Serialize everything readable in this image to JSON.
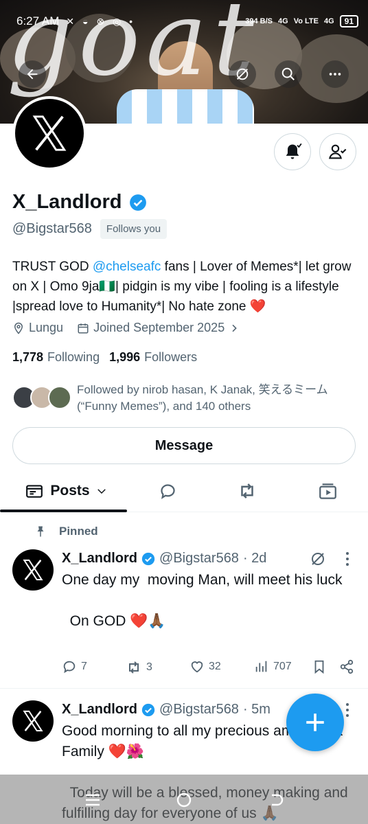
{
  "status_bar": {
    "time": "6:27 AM",
    "indicator_dots": "✕ ◒ ⊗ ◎ •",
    "net_speed": "394 B/S",
    "net1": "4G",
    "net2": "Vo LTE",
    "net3": "4G",
    "battery": "91"
  },
  "banner": {
    "overlay_text": "goat"
  },
  "profile": {
    "name": "X_Landlord",
    "handle": "@Bigstar568",
    "follows_you": "Follows you",
    "bio_before": "TRUST GOD ",
    "bio_mention": "@chelseafc",
    "bio_after": " fans | Lover of Memes*| let grow on X | Omo 9ja🇳🇬| pidgin is my vibe | fooling is a lifestyle |spread love to Humanity*| No hate zone ❤️",
    "location": "Lungu",
    "joined": "Joined September 2025",
    "following_count": "1,778",
    "following_label": "Following",
    "followers_count": "1,996",
    "followers_label": "Followers",
    "followed_by": "Followed by nirob hasan, K Janak, 笑えるミーム (“Funny Memes”), and 140 others",
    "message_label": "Message"
  },
  "tabs": {
    "posts_label": "Posts"
  },
  "pinned_label": "Pinned",
  "posts": [
    {
      "name": "X_Landlord",
      "handle": "@Bigstar568",
      "time": "· 2d",
      "text": "One day my  moving Man, will meet his luck\n\n  On GOD ❤️🙏🏾",
      "replies": "7",
      "reposts": "3",
      "likes": "32",
      "views": "707"
    },
    {
      "name": "X_Landlord",
      "handle": "@Bigstar568",
      "time": "· 5m",
      "text": "Good morning to all my precious amazing 𝕏 Family ❤️🌺\n\n  Today will be a blessed, money making and fulfilling day for everyone of us 🙏🏾"
    }
  ],
  "colors": {
    "accent": "#1d9bf0",
    "secondary_text": "#536471",
    "primary_text": "#0f1419"
  },
  "icons": [
    "back-arrow-icon",
    "grok-icon",
    "search-icon",
    "more-icon",
    "bell-icon",
    "following-icon",
    "verified-icon",
    "location-icon",
    "calendar-icon",
    "chevron-right-icon",
    "pin-icon",
    "reply-icon",
    "repost-icon",
    "like-icon",
    "views-icon",
    "bookmark-icon",
    "share-icon",
    "plus-icon"
  ]
}
